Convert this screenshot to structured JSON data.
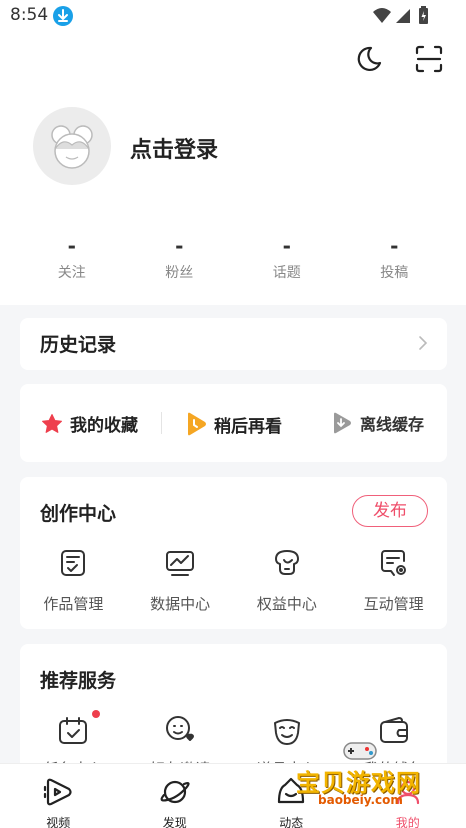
{
  "status_bar": {
    "time": "8:54"
  },
  "profile": {
    "login_text": "点击登录"
  },
  "stats": [
    {
      "value": "-",
      "label": "关注"
    },
    {
      "value": "-",
      "label": "粉丝"
    },
    {
      "value": "-",
      "label": "话题"
    },
    {
      "value": "-",
      "label": "投稿"
    }
  ],
  "history": {
    "title": "历史记录"
  },
  "quick_actions": [
    {
      "label": "我的收藏",
      "icon": "star-icon"
    },
    {
      "label": "稍后再看",
      "icon": "watch-later-icon"
    },
    {
      "label": "离线缓存",
      "icon": "offline-cache-icon"
    }
  ],
  "creation": {
    "title": "创作中心",
    "publish_label": "发布",
    "items": [
      {
        "label": "作品管理",
        "icon": "works-icon"
      },
      {
        "label": "数据中心",
        "icon": "data-chart-icon"
      },
      {
        "label": "权益中心",
        "icon": "benefits-icon"
      },
      {
        "label": "互动管理",
        "icon": "interaction-icon"
      }
    ]
  },
  "services": {
    "title": "推荐服务",
    "items": [
      {
        "label": "任务中心",
        "icon": "calendar-check-icon"
      },
      {
        "label": "好友邀请",
        "icon": "friend-invite-icon"
      },
      {
        "label": "道具中心",
        "icon": "mask-icon"
      },
      {
        "label": "我的钱包",
        "icon": "wallet-icon"
      }
    ]
  },
  "bottom_nav": [
    {
      "label": "视频",
      "icon": "video-icon"
    },
    {
      "label": "发现",
      "icon": "planet-icon"
    },
    {
      "label": "动态",
      "icon": "dynamic-icon"
    },
    {
      "label": "我的",
      "icon": "profile-icon",
      "active": true
    }
  ],
  "watermark": {
    "text": "宝贝游戏网",
    "url": "baobeiy.com"
  },
  "colors": {
    "accent": "#ef4e6a",
    "star": "#ee3f4d",
    "later": "#f5a623"
  }
}
